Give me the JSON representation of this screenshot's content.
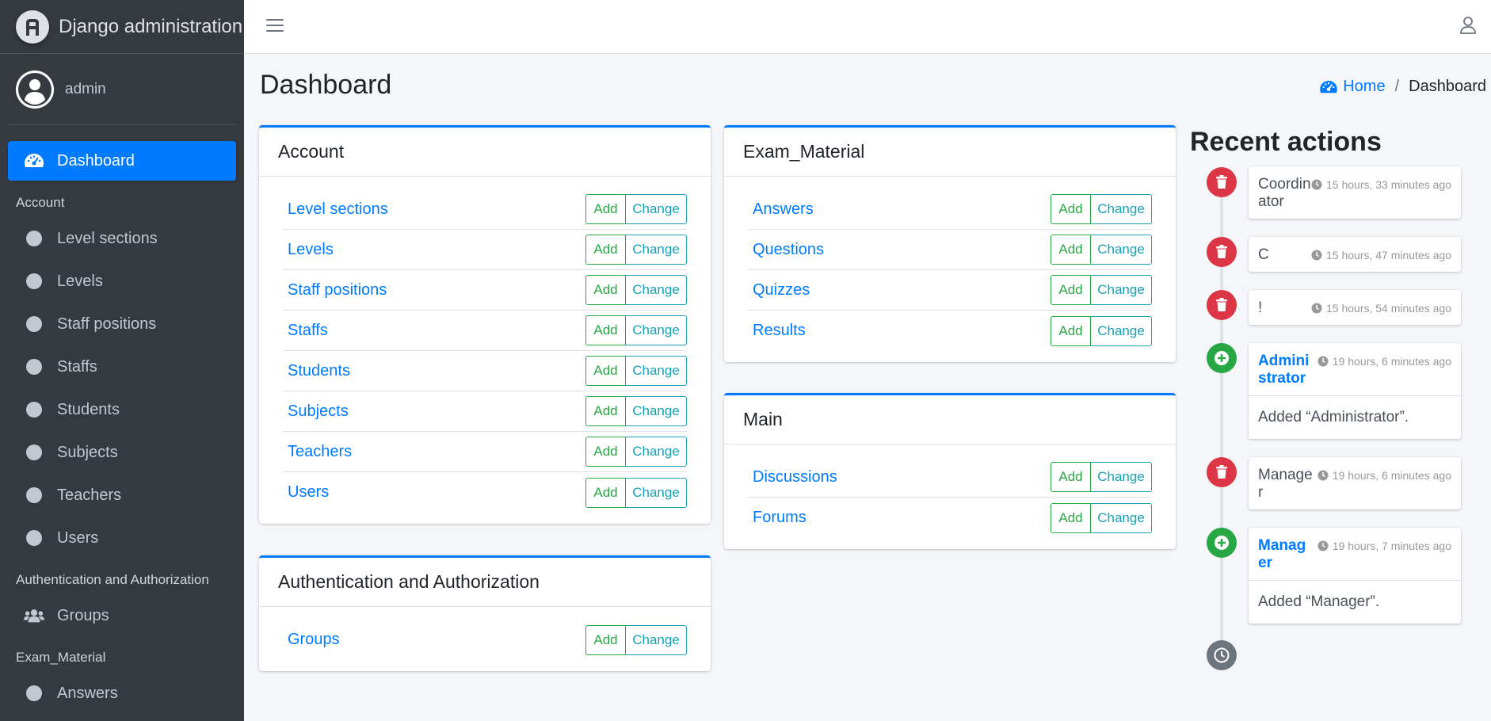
{
  "brand": {
    "title": "Django administration"
  },
  "user": {
    "name": "admin"
  },
  "sidebar": {
    "dashboard": "Dashboard",
    "sections": [
      {
        "header": "Account",
        "items": [
          "Level sections",
          "Levels",
          "Staff positions",
          "Staffs",
          "Students",
          "Subjects",
          "Teachers",
          "Users"
        ]
      },
      {
        "header": "Authentication and Authorization",
        "items": [
          "Groups"
        ]
      },
      {
        "header": "Exam_Material",
        "items": [
          "Answers"
        ]
      }
    ]
  },
  "page": {
    "title": "Dashboard"
  },
  "breadcrumb": {
    "home": "Home",
    "current": "Dashboard"
  },
  "buttons": {
    "add": "Add",
    "change": "Change"
  },
  "apps": {
    "account": {
      "title": "Account",
      "models": [
        "Level sections",
        "Levels",
        "Staff positions",
        "Staffs",
        "Students",
        "Subjects",
        "Teachers",
        "Users"
      ]
    },
    "auth": {
      "title": "Authentication and Authorization",
      "models": [
        "Groups"
      ]
    },
    "exam": {
      "title": "Exam_Material",
      "models": [
        "Answers",
        "Questions",
        "Quizzes",
        "Results"
      ]
    },
    "main": {
      "title": "Main",
      "models": [
        "Discussions",
        "Forums"
      ]
    }
  },
  "recent": {
    "title": "Recent actions",
    "items": [
      {
        "type": "delete",
        "name": "Coordinator",
        "time": "15 hours, 33 minutes ago",
        "body": ""
      },
      {
        "type": "delete",
        "name": "C",
        "time": "15 hours, 47 minutes ago",
        "body": ""
      },
      {
        "type": "delete",
        "name": "!",
        "time": "15 hours, 54 minutes ago",
        "body": ""
      },
      {
        "type": "add",
        "name": "Administrator",
        "time": "19 hours, 6 minutes ago",
        "body": "Added “Administrator”."
      },
      {
        "type": "delete",
        "name": "Manager",
        "time": "19 hours, 6 minutes ago",
        "body": ""
      },
      {
        "type": "add",
        "name": "Manager",
        "time": "19 hours, 7 minutes ago",
        "body": "Added “Manager”."
      }
    ]
  },
  "colors": {
    "primary": "#007bff",
    "sidebar": "#343a40",
    "success": "#28a745",
    "info": "#17a2b8",
    "danger": "#dc3545"
  }
}
